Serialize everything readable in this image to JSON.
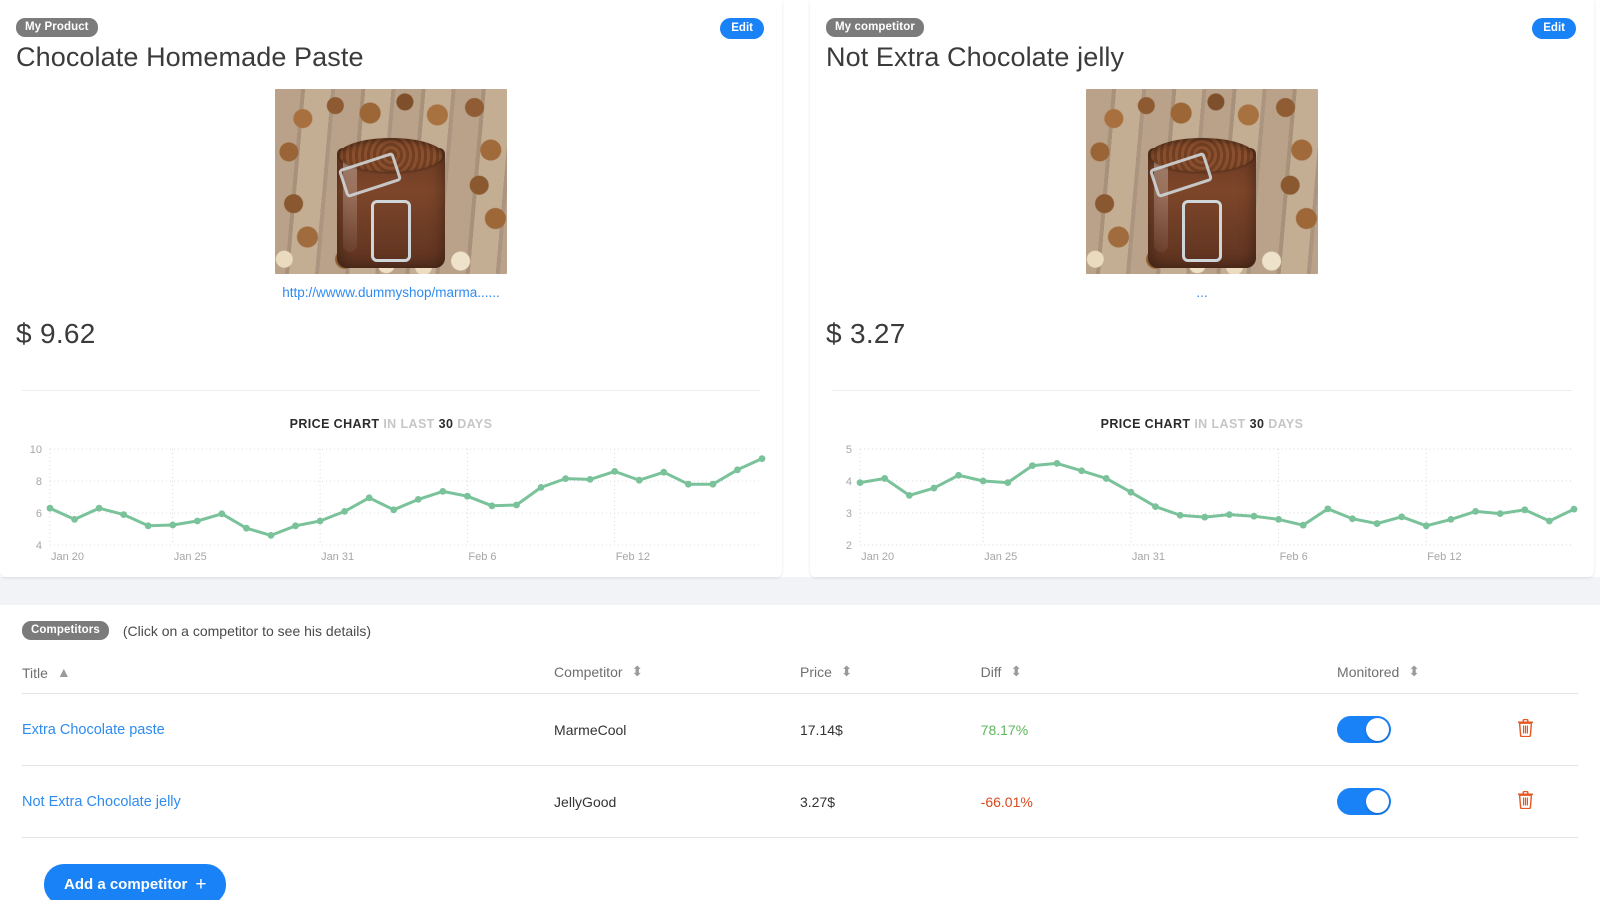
{
  "left_panel": {
    "badge": "My Product",
    "title": "Chocolate Homemade Paste",
    "edit_label": "Edit",
    "image_alt": "chocolate-paste-jar-with-hazelnuts",
    "link_text": "http://wwww.dummyshop/marma......",
    "price": "$ 9.62",
    "chart_head": {
      "part1": "PRICE CHART",
      "part2": "IN LAST",
      "part3": "30",
      "part4": "DAYS"
    }
  },
  "right_panel": {
    "badge": "My competitor",
    "title": "Not Extra Chocolate jelly",
    "edit_label": "Edit",
    "image_alt": "chocolate-paste-jar-with-hazelnuts",
    "link_text": "...",
    "price": "$ 3.27",
    "chart_head": {
      "part1": "PRICE CHART",
      "part2": "IN LAST",
      "part3": "30",
      "part4": "DAYS"
    }
  },
  "competitors_section": {
    "badge": "Competitors",
    "note": "(Click on a competitor to see his details)",
    "columns": [
      {
        "label": "Title",
        "sort": "asc"
      },
      {
        "label": "Competitor",
        "sort": "none"
      },
      {
        "label": "Price",
        "sort": "none"
      },
      {
        "label": "Diff",
        "sort": "none"
      },
      {
        "label": "Monitored",
        "sort": "none"
      }
    ],
    "rows": [
      {
        "title": "Extra Chocolate paste",
        "competitor": "MarmeCool",
        "price": "17.14$",
        "diff": "78.17%",
        "diff_sign": "positive",
        "monitored": true
      },
      {
        "title": "Not Extra Chocolate jelly",
        "competitor": "JellyGood",
        "price": "3.27$",
        "diff": "-66.01%",
        "diff_sign": "negative",
        "monitored": true
      }
    ],
    "add_label": "Add a competitor",
    "add_icon": "plus-icon"
  },
  "colors": {
    "accent_blue": "#1a82f7",
    "badge_gray": "#7b7b7b",
    "line_green": "#7ac29a",
    "diff_positive": "#5cb85c",
    "diff_negative": "#d9491e",
    "band_gray": "#f2f3f7",
    "trash_orange": "#e8551f"
  },
  "chart_data": [
    {
      "id": "left",
      "type": "line",
      "title": "PRICE CHART IN LAST 30 DAYS",
      "xlabel": "",
      "ylabel": "",
      "ylim": [
        4,
        10
      ],
      "yticks": [
        4,
        6,
        8,
        10
      ],
      "xticks": [
        "Jan 20",
        "Jan 25",
        "Jan 31",
        "Feb 6",
        "Feb 12"
      ],
      "xtick_index": [
        0,
        5,
        11,
        17,
        23
      ],
      "grid": true,
      "legend": "none",
      "series": [
        {
          "name": "price",
          "color": "#7ac29a",
          "values": [
            6.3,
            5.6,
            6.3,
            5.9,
            5.2,
            5.25,
            5.5,
            5.95,
            5.05,
            4.6,
            5.2,
            5.5,
            6.1,
            6.95,
            6.2,
            6.85,
            7.35,
            7.05,
            6.45,
            6.5,
            7.6,
            8.15,
            8.1,
            8.6,
            8.05,
            8.55,
            7.8,
            7.8,
            8.7,
            9.4
          ]
        }
      ]
    },
    {
      "id": "right",
      "type": "line",
      "title": "PRICE CHART IN LAST 30 DAYS",
      "xlabel": "",
      "ylabel": "",
      "ylim": [
        2,
        5
      ],
      "yticks": [
        2,
        3,
        4,
        5
      ],
      "xticks": [
        "Jan 20",
        "Jan 25",
        "Jan 31",
        "Feb 6",
        "Feb 12"
      ],
      "xtick_index": [
        0,
        5,
        11,
        17,
        23
      ],
      "grid": true,
      "legend": "none",
      "series": [
        {
          "name": "price",
          "color": "#7ac29a",
          "values": [
            3.95,
            4.08,
            3.55,
            3.78,
            4.18,
            4.0,
            3.95,
            4.48,
            4.55,
            4.32,
            4.08,
            3.65,
            3.2,
            2.93,
            2.87,
            2.95,
            2.9,
            2.8,
            2.62,
            3.13,
            2.82,
            2.67,
            2.88,
            2.6,
            2.8,
            3.05,
            2.98,
            3.1,
            2.75,
            3.12
          ]
        }
      ]
    }
  ]
}
